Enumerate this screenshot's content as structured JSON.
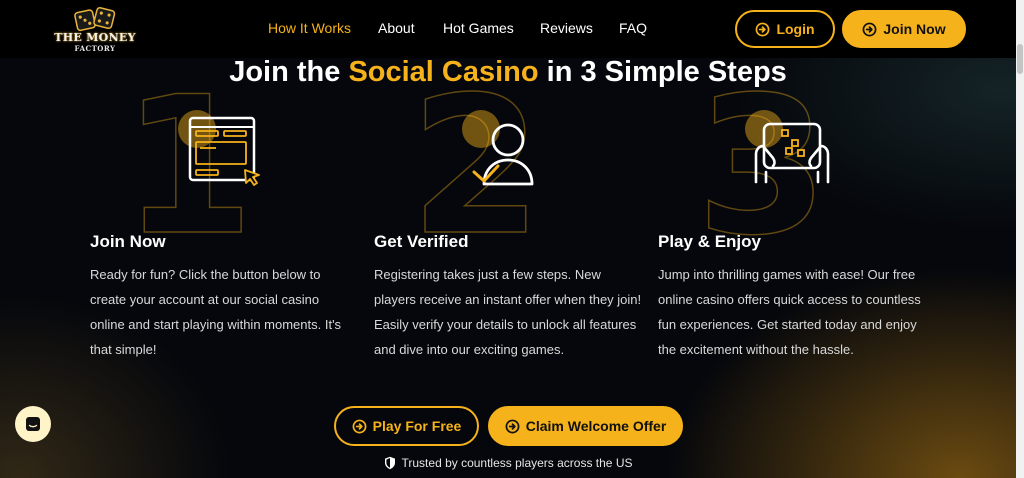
{
  "brand": {
    "line1": "THE MONEY",
    "line2": "FACTORY"
  },
  "nav": {
    "items": [
      {
        "label": "How It Works",
        "active": true
      },
      {
        "label": "About"
      },
      {
        "label": "Hot Games"
      },
      {
        "label": "Reviews"
      },
      {
        "label": "FAQ"
      }
    ],
    "login_label": "Login",
    "join_label": "Join Now"
  },
  "hero": {
    "title_pre": "Join the ",
    "title_accent": "Social Casino",
    "title_post": " in 3 Simple Steps"
  },
  "steps": [
    {
      "number": "1",
      "title": "Join Now",
      "icon": "browser-form-cursor-icon",
      "text": "Ready for fun? Click the button below to create your account at our social casino online and start playing within moments. It's that simple!"
    },
    {
      "number": "2",
      "title": "Get Verified",
      "icon": "user-check-icon",
      "text": "Registering takes just a few steps. New players receive an instant offer when they join! Easily verify your details to unlock all features and dive into our exciting games."
    },
    {
      "number": "3",
      "title": "Play & Enjoy",
      "icon": "tablet-hands-game-icon",
      "text": "Jump into thrilling games with ease! Our free online casino offers quick access to countless fun experiences. Get started today and enjoy the excitement without the hassle."
    }
  ],
  "cta": {
    "play_label": "Play For Free",
    "claim_label": "Claim Welcome Offer"
  },
  "trust_text": "Trusted by countless players across the US",
  "colors": {
    "accent": "#f6b21a",
    "background": "#05070c",
    "header": "#000000"
  }
}
